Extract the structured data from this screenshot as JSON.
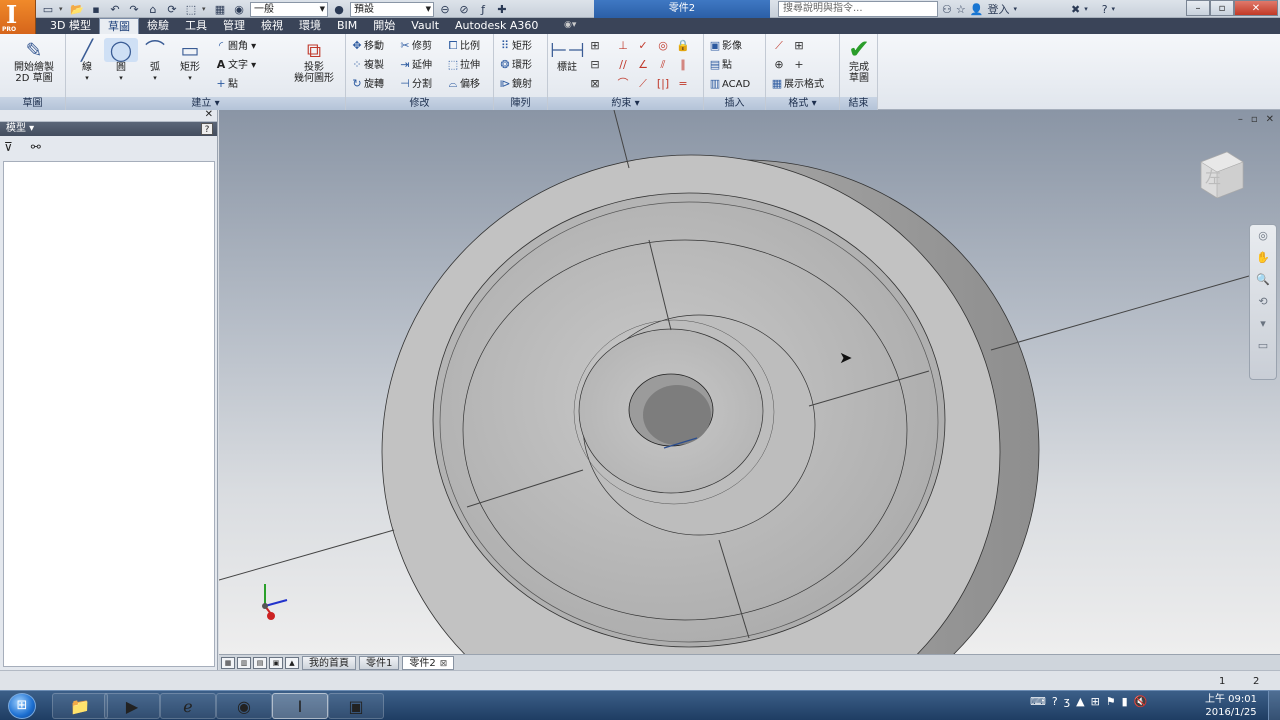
{
  "app": {
    "logo_text": "I",
    "logo_sub": "PRO"
  },
  "quick_access": {
    "appearance_combo": "一般",
    "material_combo": "預設"
  },
  "document_title": "零件2",
  "help_search_placeholder": "搜尋說明與指令...",
  "login_label": "登入",
  "ribbon_tabs": [
    {
      "label": "3D 模型",
      "active": false
    },
    {
      "label": "草圖",
      "active": true
    },
    {
      "label": "檢驗",
      "active": false
    },
    {
      "label": "工具",
      "active": false
    },
    {
      "label": "管理",
      "active": false
    },
    {
      "label": "檢視",
      "active": false
    },
    {
      "label": "環境",
      "active": false
    },
    {
      "label": "BIM",
      "active": false
    },
    {
      "label": "開始",
      "active": false
    },
    {
      "label": "Vault",
      "active": false
    },
    {
      "label": "Autodesk A360",
      "active": false
    }
  ],
  "ribbon": {
    "sketch_panel": {
      "label": "草圖",
      "start_sketch": "開始繪製\n2D 草圖"
    },
    "create_panel": {
      "label": "建立 ▾",
      "line": "線",
      "circle": "圓",
      "arc": "弧",
      "rectangle": "矩形",
      "fillet": "圓角",
      "text": "文字",
      "point": "點",
      "project": "投影\n幾何圖形"
    },
    "modify_panel": {
      "label": "修改",
      "move": "移動",
      "trim": "修剪",
      "scale": "比例",
      "copy": "複製",
      "extend": "延伸",
      "stretch": "拉伸",
      "rotate": "旋轉",
      "split": "分割",
      "offset": "偏移"
    },
    "pattern_panel": {
      "label": "陣列",
      "rect": "矩形",
      "circ": "環形",
      "mirror": "鏡射"
    },
    "constrain_panel": {
      "label": "約束 ▾",
      "dimension": "標註"
    },
    "insert_panel": {
      "label": "插入",
      "image": "影像",
      "points": "點",
      "acad": "ACAD"
    },
    "format_panel": {
      "label": "格式 ▾",
      "show_format": "展示格式"
    },
    "exit_panel": {
      "label": "結束",
      "finish": "完成\n草圖"
    }
  },
  "browser": {
    "title": "模型 ▾",
    "help": "?"
  },
  "viewcube_label": "左",
  "document_tabs": [
    {
      "label": "我的首頁",
      "active": false
    },
    {
      "label": "零件1",
      "active": false
    },
    {
      "label": "零件2",
      "active": true
    }
  ],
  "status": {
    "page_a": "1",
    "page_b": "2"
  },
  "taskbar": {
    "clock_time": "上午 09:01",
    "clock_date": "2016/1/25"
  },
  "colors": {
    "ribbon_tab_bg": "#3a4458",
    "doc_title_bg": "#2b5fa7",
    "finish_check": "#2a9d2a",
    "taskbar": "#1f3d63"
  }
}
